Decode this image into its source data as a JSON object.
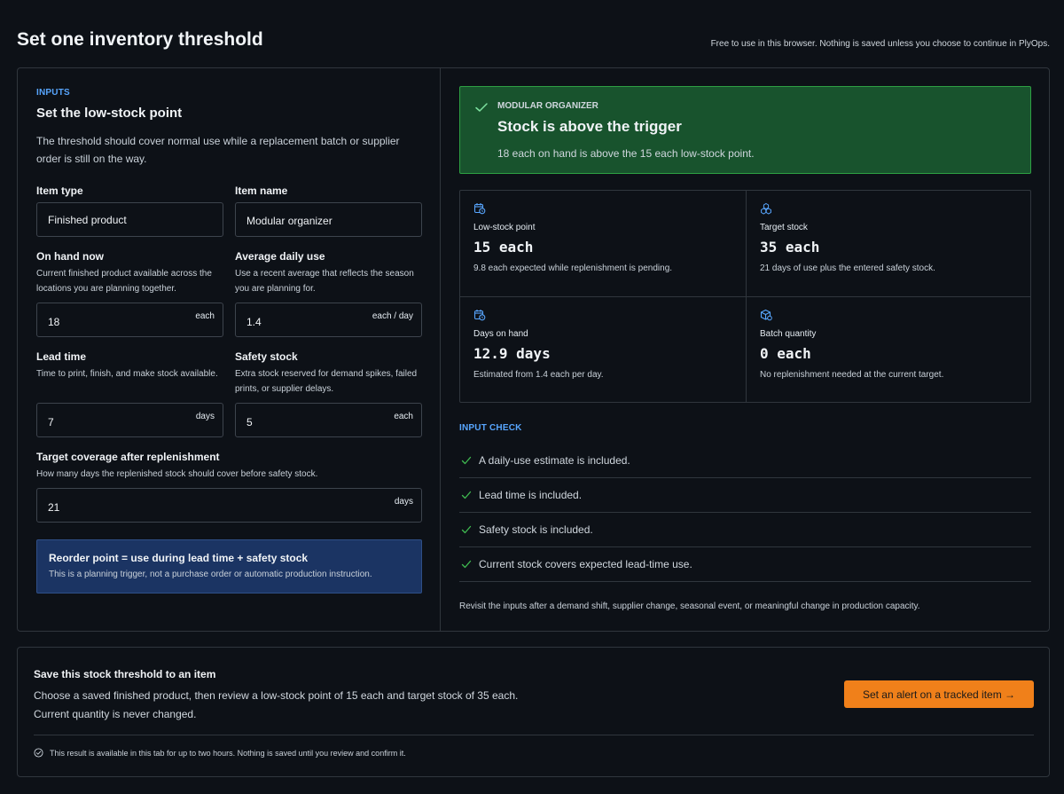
{
  "header": {
    "title": "Set one inventory threshold",
    "note": "Free to use in this browser. Nothing is saved unless you choose to continue in PlyOps."
  },
  "inputs": {
    "eyebrow": "INPUTS",
    "title": "Set the low-stock point",
    "description": "The threshold should cover normal use while a replacement batch or supplier order is still on the way.",
    "item_type": {
      "label": "Item type",
      "value": "Finished product"
    },
    "item_name": {
      "label": "Item name",
      "value": "Modular organizer"
    },
    "on_hand": {
      "label": "On hand now",
      "help": "Current finished product available across the locations you are planning together.",
      "value": "18",
      "unit": "each"
    },
    "daily_use": {
      "label": "Average daily use",
      "help": "Use a recent average that reflects the season you are planning for.",
      "value": "1.4",
      "unit": "each / day"
    },
    "lead_time": {
      "label": "Lead time",
      "help": "Time to print, finish, and make stock available.",
      "value": "7",
      "unit": "days"
    },
    "safety_stock": {
      "label": "Safety stock",
      "help": "Extra stock reserved for demand spikes, failed prints, or supplier delays.",
      "value": "5",
      "unit": "each"
    },
    "target_coverage": {
      "label": "Target coverage after replenishment",
      "help": "How many days the replenished stock should cover before safety stock.",
      "value": "21",
      "unit": "days"
    },
    "formula": {
      "title": "Reorder point = use during lead time + safety stock",
      "subtitle": "This is a planning trigger, not a purchase order or automatic production instruction."
    }
  },
  "status": {
    "eyebrow": "MODULAR ORGANIZER",
    "title": "Stock is above the trigger",
    "description": "18 each on hand is above the 15 each low-stock point.",
    "color": "#18532d"
  },
  "metrics": {
    "low_stock": {
      "icon": "calendar-clock-icon",
      "label": "Low-stock point",
      "value": "15 each",
      "note": "9.8 each expected while replenishment is pending."
    },
    "target": {
      "icon": "boxes-icon",
      "label": "Target stock",
      "value": "35 each",
      "note": "21 days of use plus the entered safety stock."
    },
    "days_on_hand": {
      "icon": "calendar-clock-icon",
      "label": "Days on hand",
      "value": "12.9 days",
      "note": "Estimated from 1.4 each per day."
    },
    "batch": {
      "icon": "package-icon",
      "label": "Batch quantity",
      "value": "0 each",
      "note": "No replenishment needed at the current target."
    }
  },
  "input_check": {
    "eyebrow": "INPUT CHECK",
    "items": [
      "A daily-use estimate is included.",
      "Lead time is included.",
      "Safety stock is included.",
      "Current stock covers expected lead-time use."
    ],
    "footer": "Revisit the inputs after a demand shift, supplier change, seasonal event, or meaningful change in production capacity."
  },
  "save": {
    "title": "Save this stock threshold to an item",
    "line1": "Choose a saved finished product, then review a low-stock point of 15 each and target stock of 35 each.",
    "line2": "Current quantity is never changed.",
    "button": "Set an alert on a tracked item →",
    "note": "This result is available in this tab for up to two hours. Nothing is saved until you review and confirm it.",
    "accent": "#f0801a"
  }
}
